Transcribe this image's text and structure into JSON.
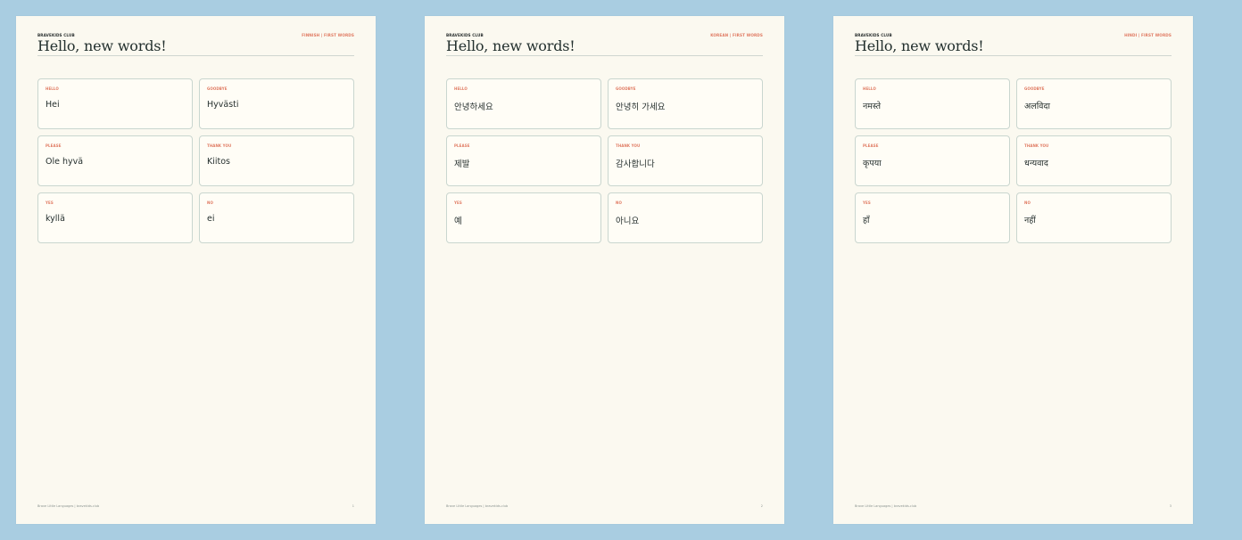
{
  "document": {
    "brand": "BRAVEKIDS CLUB",
    "title": "Hello, new words!",
    "footer": "Brave Little Languages | bravekids.club",
    "labels": {
      "hello": "HELLO",
      "goodbye": "GOODBYE",
      "please": "PLEASE",
      "thank_you": "THANK YOU",
      "yes": "YES",
      "no": "NO"
    }
  },
  "pages": [
    {
      "topic": "FINNISH | FIRST WORDS",
      "page_number": "1",
      "words": {
        "hello": "Hei",
        "goodbye": "Hyvästi",
        "please": "Ole hyvä",
        "thank_you": "Kiitos",
        "yes": "kyllä",
        "no": "ei"
      }
    },
    {
      "topic": "KOREAN | FIRST WORDS",
      "page_number": "2",
      "words": {
        "hello": "안녕하세요",
        "goodbye": "안녕히 가세요",
        "please": "제발",
        "thank_you": "감사합니다",
        "yes": "예",
        "no": "아니요"
      }
    },
    {
      "topic": "HINDI | FIRST WORDS",
      "page_number": "3",
      "words": {
        "hello": "नमस्ते",
        "goodbye": "अलविदा",
        "please": "कृपया",
        "thank_you": "धन्यवाद",
        "yes": "हाँ",
        "no": "नहीं"
      }
    }
  ],
  "colors": {
    "background": "#a9cde1",
    "page": "#fbf9f0",
    "accent": "#e07a62",
    "text": "#23302e",
    "card_border": "#c9d6cf"
  }
}
